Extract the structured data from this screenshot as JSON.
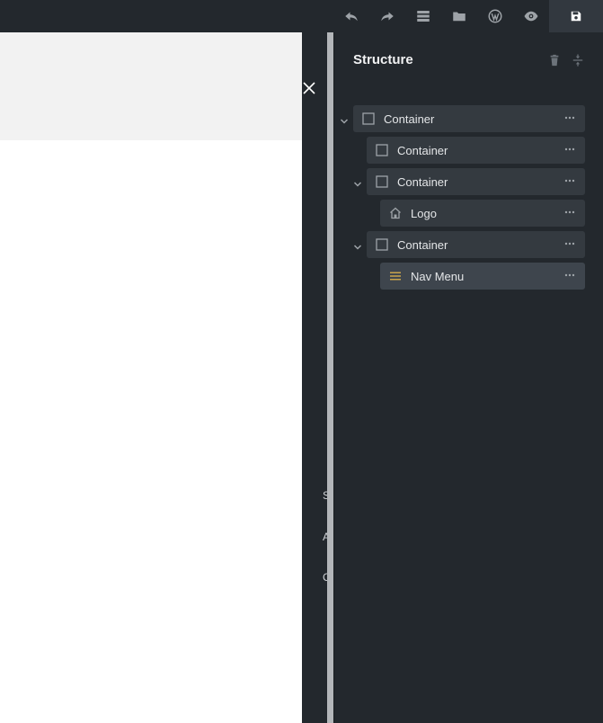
{
  "toolbar": {
    "buttons": [
      {
        "name": "undo",
        "icon": "undo-icon"
      },
      {
        "name": "redo",
        "icon": "redo-icon"
      },
      {
        "name": "templates",
        "icon": "stack-icon"
      },
      {
        "name": "pages",
        "icon": "folder-icon"
      },
      {
        "name": "wordpress",
        "icon": "wordpress-icon"
      },
      {
        "name": "preview",
        "icon": "eye-icon"
      },
      {
        "name": "save",
        "icon": "save-icon"
      }
    ]
  },
  "offcanvas": {
    "letters": [
      "S",
      "A",
      "C"
    ]
  },
  "structure": {
    "title": "Structure",
    "items": [
      {
        "label": "Container",
        "icon": "container-icon",
        "expanded": true
      },
      {
        "label": "Container",
        "icon": "container-icon"
      },
      {
        "label": "Container",
        "icon": "container-icon",
        "expanded": true
      },
      {
        "label": "Logo",
        "icon": "home-icon"
      },
      {
        "label": "Container",
        "icon": "container-icon",
        "expanded": true
      },
      {
        "label": "Nav Menu",
        "icon": "menu-icon",
        "active": true
      }
    ]
  },
  "colors": {
    "background": "#23282d",
    "row": "#343a40",
    "row_active": "#3e454d",
    "menu_icon": "#c9a44c"
  }
}
